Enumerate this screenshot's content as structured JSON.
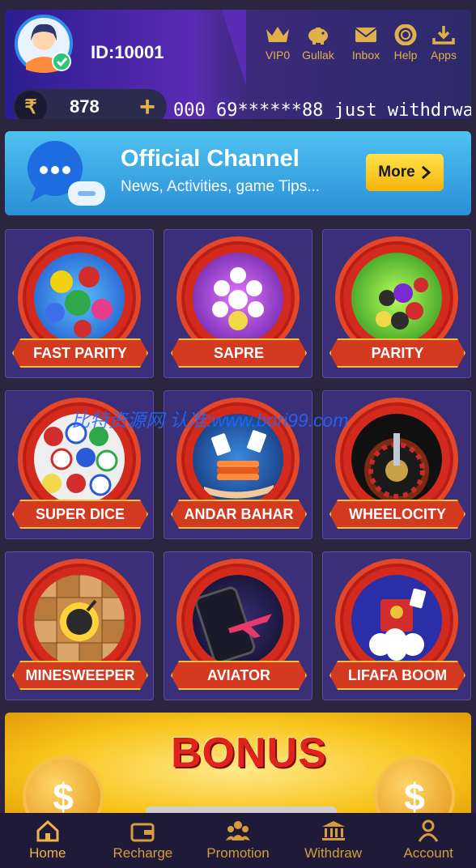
{
  "header": {
    "user_id": "ID:10001",
    "balance": "878",
    "currency_symbol": "₹",
    "plus_symbol": "+",
    "marquee": "000 69******88 just withdrwa",
    "quick_links": [
      {
        "label": "VIP0",
        "icon": "crown-icon"
      },
      {
        "label": "Gullak",
        "icon": "piggy-bank-icon"
      },
      {
        "label": "Inbox",
        "icon": "mail-icon"
      },
      {
        "label": "Help",
        "icon": "lifebuoy-icon"
      },
      {
        "label": "Apps",
        "icon": "download-icon"
      }
    ]
  },
  "channel": {
    "title": "Official Channel",
    "subtitle": "News, Activities, game Tips...",
    "button": "More"
  },
  "games": [
    {
      "name": "FAST PARITY"
    },
    {
      "name": "SAPRE"
    },
    {
      "name": "PARITY"
    },
    {
      "name": "SUPER DICE"
    },
    {
      "name": "ANDAR BAHAR"
    },
    {
      "name": "WHEELOCITY"
    },
    {
      "name": "MINESWEEPER"
    },
    {
      "name": "AVIATOR"
    },
    {
      "name": "LIFAFA BOOM"
    }
  ],
  "watermark": "比特资源网 认准:www.bori99.com",
  "bonus": {
    "title": "BONUS",
    "coin_symbol": "$"
  },
  "nav": [
    {
      "label": "Home",
      "icon": "home-icon"
    },
    {
      "label": "Recharge",
      "icon": "wallet-icon"
    },
    {
      "label": "Promotion",
      "icon": "people-icon"
    },
    {
      "label": "Withdraw",
      "icon": "bank-icon"
    },
    {
      "label": "Account",
      "icon": "user-icon"
    }
  ],
  "colors": {
    "accent": "#e2b04a",
    "background": "#2b2540",
    "tile": "#3a2f78",
    "ribbon": "#d33a1f"
  }
}
